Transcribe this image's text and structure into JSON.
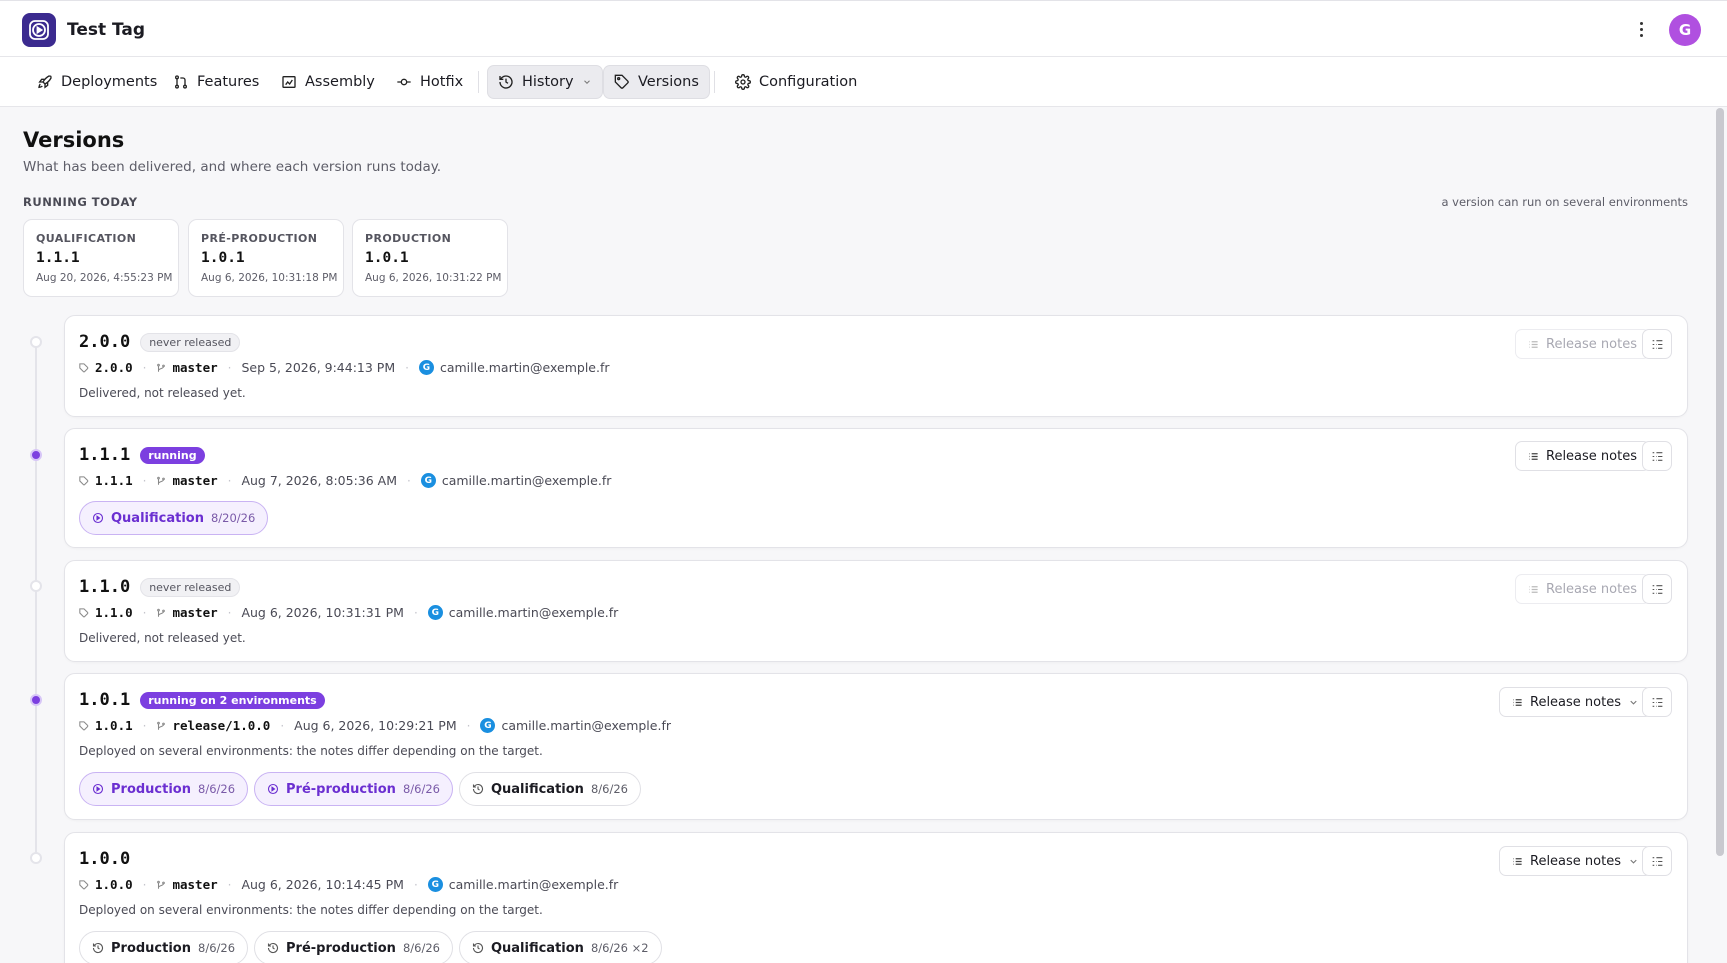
{
  "app": {
    "title": "Test Tag",
    "avatar_initial": "G"
  },
  "nav": {
    "items": [
      {
        "label": "Deployments",
        "icon": "rocket-icon"
      },
      {
        "label": "Features",
        "icon": "git-branch-icon"
      },
      {
        "label": "Assembly",
        "icon": "assembly-icon"
      },
      {
        "label": "Hotfix",
        "icon": "commit-icon"
      },
      {
        "label": "History",
        "icon": "history-icon",
        "active": true
      },
      {
        "label": "Versions",
        "icon": "tag-icon",
        "active": true
      },
      {
        "label": "Configuration",
        "icon": "gear-icon"
      }
    ]
  },
  "page": {
    "title": "Versions",
    "subtitle": "What has been delivered, and where each version runs today.",
    "running_label": "RUNNING TODAY",
    "running_hint": "a version can run on several environments"
  },
  "running": [
    {
      "env": "QUALIFICATION",
      "version": "1.1.1",
      "date": "Aug 20, 2026, 4:55:23 PM"
    },
    {
      "env": "PRÉ-PRODUCTION",
      "version": "1.0.1",
      "date": "Aug 6, 2026, 10:31:18 PM"
    },
    {
      "env": "PRODUCTION",
      "version": "1.0.1",
      "date": "Aug 6, 2026, 10:31:22 PM"
    }
  ],
  "versions": [
    {
      "number": "2.0.0",
      "badge": "never released",
      "tag": "2.0.0",
      "branch": "master",
      "date": "Sep 5, 2026, 9:44:13 PM",
      "author": "camille.martin@exemple.fr",
      "author_initial": "G",
      "note": "Delivered, not released yet.",
      "release_notes": "Release notes"
    },
    {
      "number": "1.1.1",
      "badge": "running",
      "tag": "1.1.1",
      "branch": "master",
      "date": "Aug 7, 2026, 8:05:36 AM",
      "author": "camille.martin@exemple.fr",
      "author_initial": "G",
      "release_notes": "Release notes",
      "chips": [
        {
          "label": "Qualification",
          "date": "8/20/26"
        }
      ]
    },
    {
      "number": "1.1.0",
      "badge": "never released",
      "tag": "1.1.0",
      "branch": "master",
      "date": "Aug 6, 2026, 10:31:31 PM",
      "author": "camille.martin@exemple.fr",
      "author_initial": "G",
      "note": "Delivered, not released yet.",
      "release_notes": "Release notes"
    },
    {
      "number": "1.0.1",
      "badge": "running on 2 environments",
      "tag": "1.0.1",
      "branch": "release/1.0.0",
      "date": "Aug 6, 2026, 10:29:21 PM",
      "author": "camille.martin@exemple.fr",
      "author_initial": "G",
      "note": "Deployed on several environments: the notes differ depending on the target.",
      "release_notes": "Release notes",
      "chips": [
        {
          "label": "Production",
          "date": "8/6/26"
        },
        {
          "label": "Pré-production",
          "date": "8/6/26"
        },
        {
          "label": "Qualification",
          "date": "8/6/26"
        }
      ]
    },
    {
      "number": "1.0.0",
      "tag": "1.0.0",
      "branch": "master",
      "date": "Aug 6, 2026, 10:14:45 PM",
      "author": "camille.martin@exemple.fr",
      "author_initial": "G",
      "note": "Deployed on several environments: the notes differ depending on the target.",
      "release_notes": "Release notes",
      "chips": [
        {
          "label": "Production",
          "date": "8/6/26"
        },
        {
          "label": "Pré-production",
          "date": "8/6/26"
        },
        {
          "label": "Qualification",
          "date": "8/6/26 ×2"
        }
      ]
    }
  ],
  "colors": {
    "accent": "#7c3fe0",
    "brand": "#3b2a8f",
    "avatar": "#b050e0",
    "author_avatar": "#1a8fe0"
  }
}
